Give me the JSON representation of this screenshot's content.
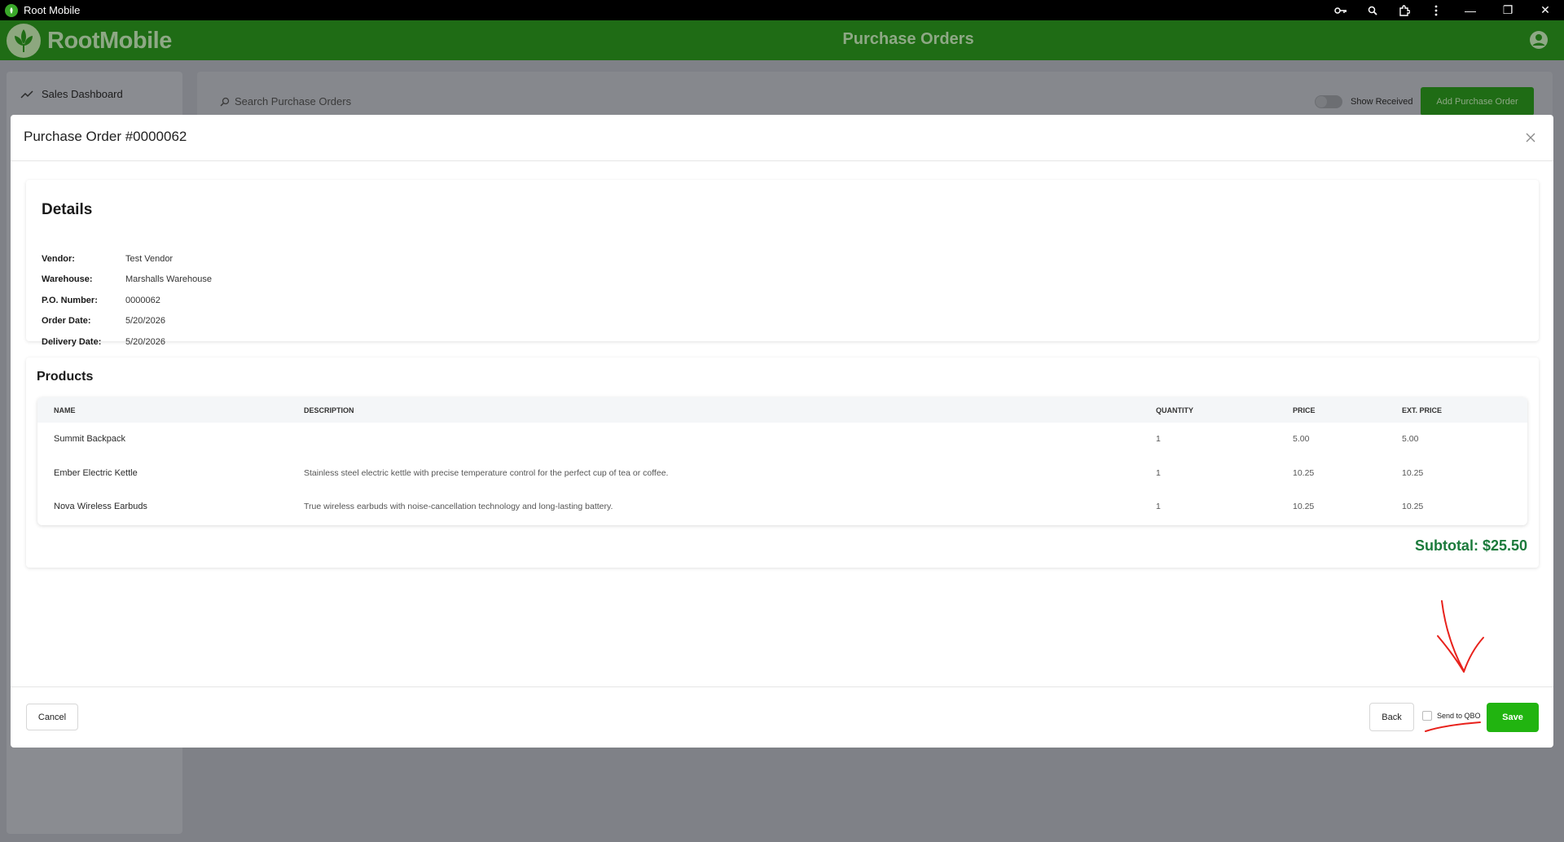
{
  "window": {
    "title": "Root Mobile",
    "controls": {
      "minimize": "—",
      "restore": "❐",
      "close": "✕"
    },
    "toolbar_icons": [
      "key-icon",
      "zoom-icon",
      "extension-icon",
      "more-vert-icon"
    ]
  },
  "header": {
    "logo_text": "RootMobile",
    "page_title": "Purchase Orders",
    "brand_color": "#1f6c15"
  },
  "sidebar": {
    "items": [
      {
        "label": "Sales Dashboard",
        "icon": "trend-icon"
      }
    ]
  },
  "toolbar": {
    "search_placeholder": "Search Purchase Orders",
    "show_received_label": "Show Received",
    "add_button_label": "Add Purchase Order"
  },
  "modal": {
    "title": "Purchase Order #0000062",
    "details": {
      "heading": "Details",
      "fields": [
        {
          "label": "Vendor:",
          "value": "Test Vendor"
        },
        {
          "label": "Warehouse:",
          "value": "Marshalls Warehouse"
        },
        {
          "label": "P.O. Number:",
          "value": "0000062"
        },
        {
          "label": "Order Date:",
          "value": "5/20/2026"
        },
        {
          "label": "Delivery Date:",
          "value": "5/20/2026"
        }
      ]
    },
    "products": {
      "heading": "Products",
      "columns": [
        "NAME",
        "DESCRIPTION",
        "QUANTITY",
        "PRICE",
        "EXT. PRICE"
      ],
      "rows": [
        {
          "name": "Summit Backpack",
          "description": "",
          "quantity": "1",
          "price": "5.00",
          "ext_price": "5.00"
        },
        {
          "name": "Ember Electric Kettle",
          "description": "Stainless steel electric kettle with precise temperature control for the perfect cup of tea or coffee.",
          "quantity": "1",
          "price": "10.25",
          "ext_price": "10.25"
        },
        {
          "name": "Nova Wireless Earbuds",
          "description": "True wireless earbuds with noise-cancellation technology and long-lasting battery.",
          "quantity": "1",
          "price": "10.25",
          "ext_price": "10.25"
        }
      ],
      "subtotal": "Subtotal: $25.50"
    },
    "footer": {
      "cancel_label": "Cancel",
      "back_label": "Back",
      "send_qbo_label": "Send to QBO",
      "send_qbo_checked": false,
      "save_label": "Save",
      "save_color": "#21b410"
    }
  }
}
